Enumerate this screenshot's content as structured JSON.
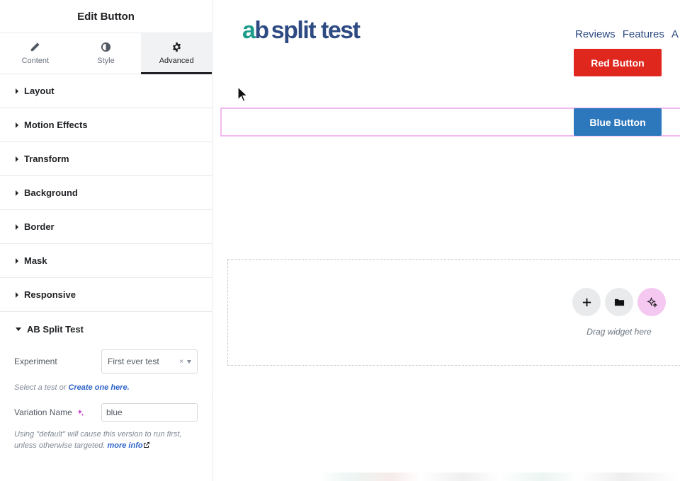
{
  "panel": {
    "title": "Edit Button",
    "tabs": [
      {
        "label": "Content",
        "icon": "pencil-icon"
      },
      {
        "label": "Style",
        "icon": "half-circle-icon"
      },
      {
        "label": "Advanced",
        "icon": "gear-icon",
        "active": true
      }
    ],
    "sections": [
      {
        "label": "Layout"
      },
      {
        "label": "Motion Effects"
      },
      {
        "label": "Transform"
      },
      {
        "label": "Background"
      },
      {
        "label": "Border"
      },
      {
        "label": "Mask"
      },
      {
        "label": "Responsive"
      },
      {
        "label": "AB Split Test",
        "open": true
      }
    ],
    "ab_split": {
      "experiment_label": "Experiment",
      "experiment_value": "First ever test",
      "experiment_clear": "×",
      "help1_text": "Select a test or ",
      "help1_link": "Create one here.",
      "variation_label": "Variation Name",
      "variation_value": "blue",
      "help2_text": "Using \"default\" will cause this version to run first, unless otherwise targeted. ",
      "help2_link": "more info"
    },
    "collapse_glyph": "‹"
  },
  "canvas": {
    "logo": {
      "a": "a",
      "b": "b",
      "rest": "split test"
    },
    "nav": [
      "Reviews",
      "Features",
      "A"
    ],
    "red_button": "Red Button",
    "blue_button": "Blue Button",
    "dropzone_text": "Drag widget here"
  },
  "colors": {
    "red_button": "#e0271e",
    "blue_button": "#2d78bd",
    "logo_teal": "#1d9c8a",
    "logo_navy": "#2d4a82",
    "selection_outline": "#f2b8f0",
    "ai_accent": "#c52cc0"
  }
}
